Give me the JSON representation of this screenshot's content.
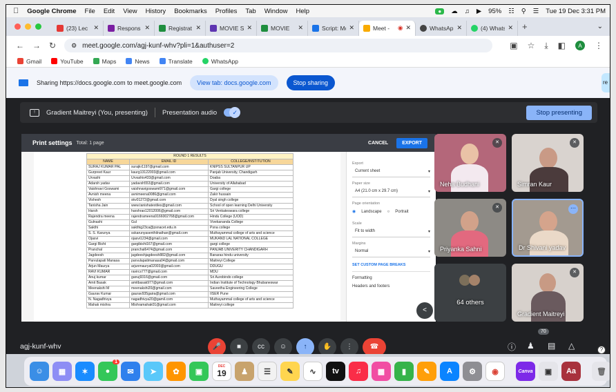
{
  "menubar": {
    "app": "Google Chrome",
    "items": [
      "File",
      "Edit",
      "View",
      "History",
      "Bookmarks",
      "Profiles",
      "Tab",
      "Window",
      "Help"
    ],
    "battery": "95%",
    "clock": "Tue 19 Dec 3:31 PM"
  },
  "tabs": [
    {
      "label": "(23) Lec",
      "color": "#e53935"
    },
    {
      "label": "Respons",
      "color": "#7b1fa2"
    },
    {
      "label": "Registrat",
      "color": "#1e8e3e"
    },
    {
      "label": "MOVIE SC",
      "color": "#5e35b1"
    },
    {
      "label": "MOVIE",
      "color": "#1e8e3e"
    },
    {
      "label": "Script: Mc",
      "color": "#1a73e8"
    },
    {
      "label": "Meet -",
      "color": "#f9ab00"
    },
    {
      "label": "WhatsAp",
      "color": "#444"
    },
    {
      "label": "(4) Whats",
      "color": "#25d366"
    }
  ],
  "address": {
    "url": "meet.google.com/agj-kunf-whv?pli=1&authuser=2",
    "profile_initial": "A"
  },
  "bookmarks": [
    {
      "label": "Gmail",
      "color": "#ea4335"
    },
    {
      "label": "YouTube",
      "color": "#ff0000"
    },
    {
      "label": "Maps",
      "color": "#34a853"
    },
    {
      "label": "News",
      "color": "#4285f4"
    },
    {
      "label": "Translate",
      "color": "#4285f4"
    },
    {
      "label": "WhatsApp",
      "color": "#25d366"
    }
  ],
  "sharing": {
    "text": "Sharing https://docs.google.com to meet.google.com",
    "view_tab": "View tab: docs.google.com",
    "stop": "Stop sharing",
    "side_label": "re"
  },
  "presenting": {
    "label": "Gradient Maitreyi (You, presenting)",
    "audio": "Presentation audio",
    "stop": "Stop presenting"
  },
  "print_settings": {
    "title": "Print settings",
    "subtitle": "Total: 1 page",
    "cancel": "CANCEL",
    "export": "EXPORT",
    "export_label": "Export",
    "export_value": "Current sheet",
    "paper_label": "Paper size",
    "paper_value": "A4 (21.0 cm x 29.7 cm)",
    "orientation_label": "Page orientation",
    "landscape": "Landscape",
    "portrait": "Portrait",
    "scale_label": "Scale",
    "scale_value": "Fit to width",
    "margins_label": "Margins",
    "margins_value": "Normal",
    "custom_breaks": "SET CUSTOM PAGE BREAKS",
    "formatting": "Formatting",
    "headers": "Headers and footers"
  },
  "sheet": {
    "caption": "ROUND 1 RESULTS",
    "headers": [
      "NAME",
      "EMAIL ID",
      "COLLEGE/INSTITUTION"
    ],
    "rows": [
      [
        "SURAJ KUMAR PAL",
        "surajkr1197@gmail.com",
        "KNIPSS SULTANPUR UP"
      ],
      [
        "Gurpreet Kaur",
        "kaurg13122003@gmail.com",
        "Panjab University, Chandigarh"
      ],
      [
        "Urvashi",
        "Urvashis433@gmail.com",
        "Doaba"
      ],
      [
        "Adarsh yadav",
        "yadavsh553@gmail.com",
        "University of Allahabad"
      ],
      [
        "Vaishnavi Goswami",
        "vaishnavigoswami971@gmail.com",
        "Gargi college"
      ],
      [
        "Avnish meena",
        "avnimeena0086@gmail.com",
        "Zakir hussain"
      ],
      [
        "Vishesh",
        "skv01272@gmail.com",
        "Dyal singh college"
      ],
      [
        "Tanisha Jain",
        "www.tanishatextiles@gmail.com",
        "School of open learning Delhi University"
      ],
      [
        "Harsh",
        "harshrao12012006@gmail.com",
        "Sri Venkateswara college"
      ],
      [
        "Rajendra meena",
        "rajendrameena9166002768@gmail.com",
        "Hindu College (UOD)"
      ],
      [
        "Gulnashi",
        "Gul",
        "Vivekananda College"
      ],
      [
        "Sakthi",
        "sakthig23ca@psnacet.edu.in",
        "Psna college"
      ],
      [
        "S. S. Karunya",
        "sskarunyasenthilnathan@gmail.com",
        "Muthayammal college of arts and science"
      ],
      [
        "Ojasvi",
        "ojasvi1234@gmail.com",
        "MUKAND LAL NATIONAL COLLEGE"
      ],
      [
        "Gargi Bisht",
        "gargibisht167@gmail.com",
        "gargi college"
      ],
      [
        "Pranchal",
        "pranchal6474@gmail.com",
        "PANJAB UNIVERITY CHANDIGARH"
      ],
      [
        "Jagdeesh",
        "jagdeeshjagdeesh882@gmail.com",
        "Banaras hindu university"
      ],
      [
        "Parvulapati Manasa",
        "parvulapatimanasa04@gmail.com",
        "Maitreyi College"
      ],
      [
        "Arjun Maurya",
        "arjunmaurya02003@gmail.com",
        "DDUGU"
      ],
      [
        "RAVI KUMAR",
        "ravircs777@gmail.com",
        "MDU"
      ],
      [
        "Anuj kumar",
        "ganuj9316@gmail.com",
        "Sri Aurobindo college"
      ],
      [
        "Amit Basak",
        "amitbasak977@gmail.com",
        "Indian Institute of Technology Bhubaneswar"
      ],
      [
        "Meenakshi M",
        "meenakshi20@gmail.com",
        "Saveetha Engineering College"
      ],
      [
        "Gaurav Kumar",
        "gaurav935gaira@gmail.com",
        "IISER Pune"
      ],
      [
        "N. Nagadhivya",
        "nagadhivya20@gamil.com",
        "Muthayammal college of arts and science"
      ],
      [
        "Mahak mishra",
        "Mishramahak01@gmail.com",
        "Maitreyi college"
      ]
    ]
  },
  "participants": [
    {
      "name": "Neha Budhani"
    },
    {
      "name": "Simran Kaur"
    },
    {
      "name": "Priyanka Sahni"
    },
    {
      "name": "Dr Shivani yadav"
    },
    {
      "name": "64 others"
    },
    {
      "name": "Gradient Maitreyi"
    }
  ],
  "meeting": {
    "code": "agj-kunf-whv",
    "people_count": "70"
  },
  "dock": {
    "calendar_month": "DEC",
    "calendar_day": "19",
    "badge": "1",
    "canva": "Canva",
    "dictionary": "Aa"
  }
}
